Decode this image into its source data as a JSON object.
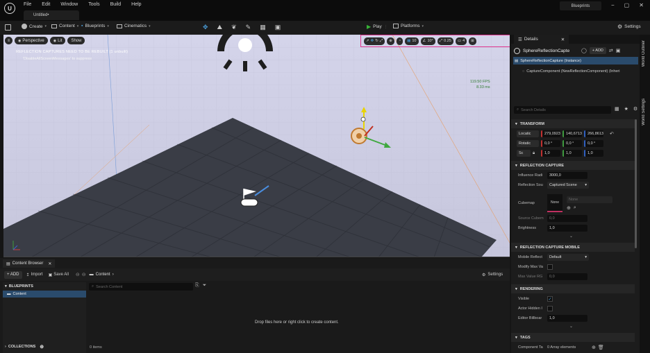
{
  "menu": [
    "File",
    "Edit",
    "Window",
    "Tools",
    "Build",
    "Help"
  ],
  "doc_tab": "Untitled•",
  "project_name": "Blueprints",
  "window_controls": [
    "−",
    "▢",
    "✕"
  ],
  "toolbar": {
    "create": "Create",
    "content": "Content",
    "blueprints": "Blueprints",
    "cinematics": "Cinematics",
    "play": "Play",
    "platforms": "Platforms",
    "settings": "Settings"
  },
  "viewport": {
    "perspective": "Perspective",
    "lit": "Lit",
    "show": "Show",
    "warning": "REFLECTION CAPTURES NEED TO BE REBUILT (1 unbuilt)",
    "suppress_hint": "'DisableAllScreenMessages' to suppress",
    "fps": "119.50 FPS",
    "ms": "8.33 ms",
    "snap": {
      "grid": "10",
      "rotation": "10°",
      "scale": "0.25",
      "camera_speed": "4"
    }
  },
  "details": {
    "tab": "Details",
    "actor_name": "SphereReflectionCapte",
    "add_label": "+ ADD",
    "instance_label": "SphereReflectionCapture (Instance)",
    "component_label": "CaptureComponent (NewReflectionComponent) (Inheri",
    "search_placeholder": "Search Details",
    "transform": {
      "header": "TRANSFORM",
      "location_label": "Locatic",
      "location": [
        "279,0923",
        "140,6713",
        "266,8613"
      ],
      "rotation_label": "Rotatic",
      "rotation": [
        "0,0 °",
        "0,0 °",
        "0,0 °"
      ],
      "scale_label": "Sc",
      "scale": [
        "1,0",
        "1,0",
        "1,0"
      ]
    },
    "reflection_capture": {
      "header": "REFLECTION CAPTURE",
      "influence_label": "Influence Radi",
      "influence_value": "3000,0",
      "source_label": "Reflection Sou",
      "source_value": "Captured Scene",
      "cubemap_label": "Cubemap",
      "cubemap_none": "None",
      "cubemap_select": "None",
      "source_cubemap_label": "Source Cubem",
      "source_cubemap_value": "0,0",
      "brightness_label": "Brightness",
      "brightness_value": "1,0"
    },
    "mobile": {
      "header": "REFLECTION CAPTURE MOBILE",
      "mobile_label": "Mobile Reflect",
      "mobile_value": "Default",
      "modify_label": "Modify Max Va",
      "max_value_label": "Max Value RG",
      "max_value": "0,0"
    },
    "rendering": {
      "header": "RENDERING",
      "visible_label": "Visible",
      "actor_hidden_label": "Actor Hidden I",
      "billboard_label": "Editor Billboar",
      "billboard_value": "1,0"
    },
    "tags": {
      "header": "TAGS",
      "component_tags_label": "Component Ta",
      "component_tags_value": "0 Array elements"
    }
  },
  "right_strip": {
    "outliner": "World Outliner",
    "world_settings": "World Settings"
  },
  "content_browser": {
    "tab": "Content Browser",
    "add": "+ ADD",
    "import": "Import",
    "save_all": "Save All",
    "path": "Content",
    "settings": "Settings",
    "blueprints_header": "BLUEPRINTS",
    "tree_item": "Content",
    "search_placeholder": "Search Content",
    "drop_hint": "Drop files here or right click to create content.",
    "collections": "COLLECTIONS",
    "items_count": "0 items"
  },
  "colors": {
    "accent_pink": "#e0328c",
    "play_green": "#37b437",
    "selection_blue": "#2a4b6c"
  }
}
